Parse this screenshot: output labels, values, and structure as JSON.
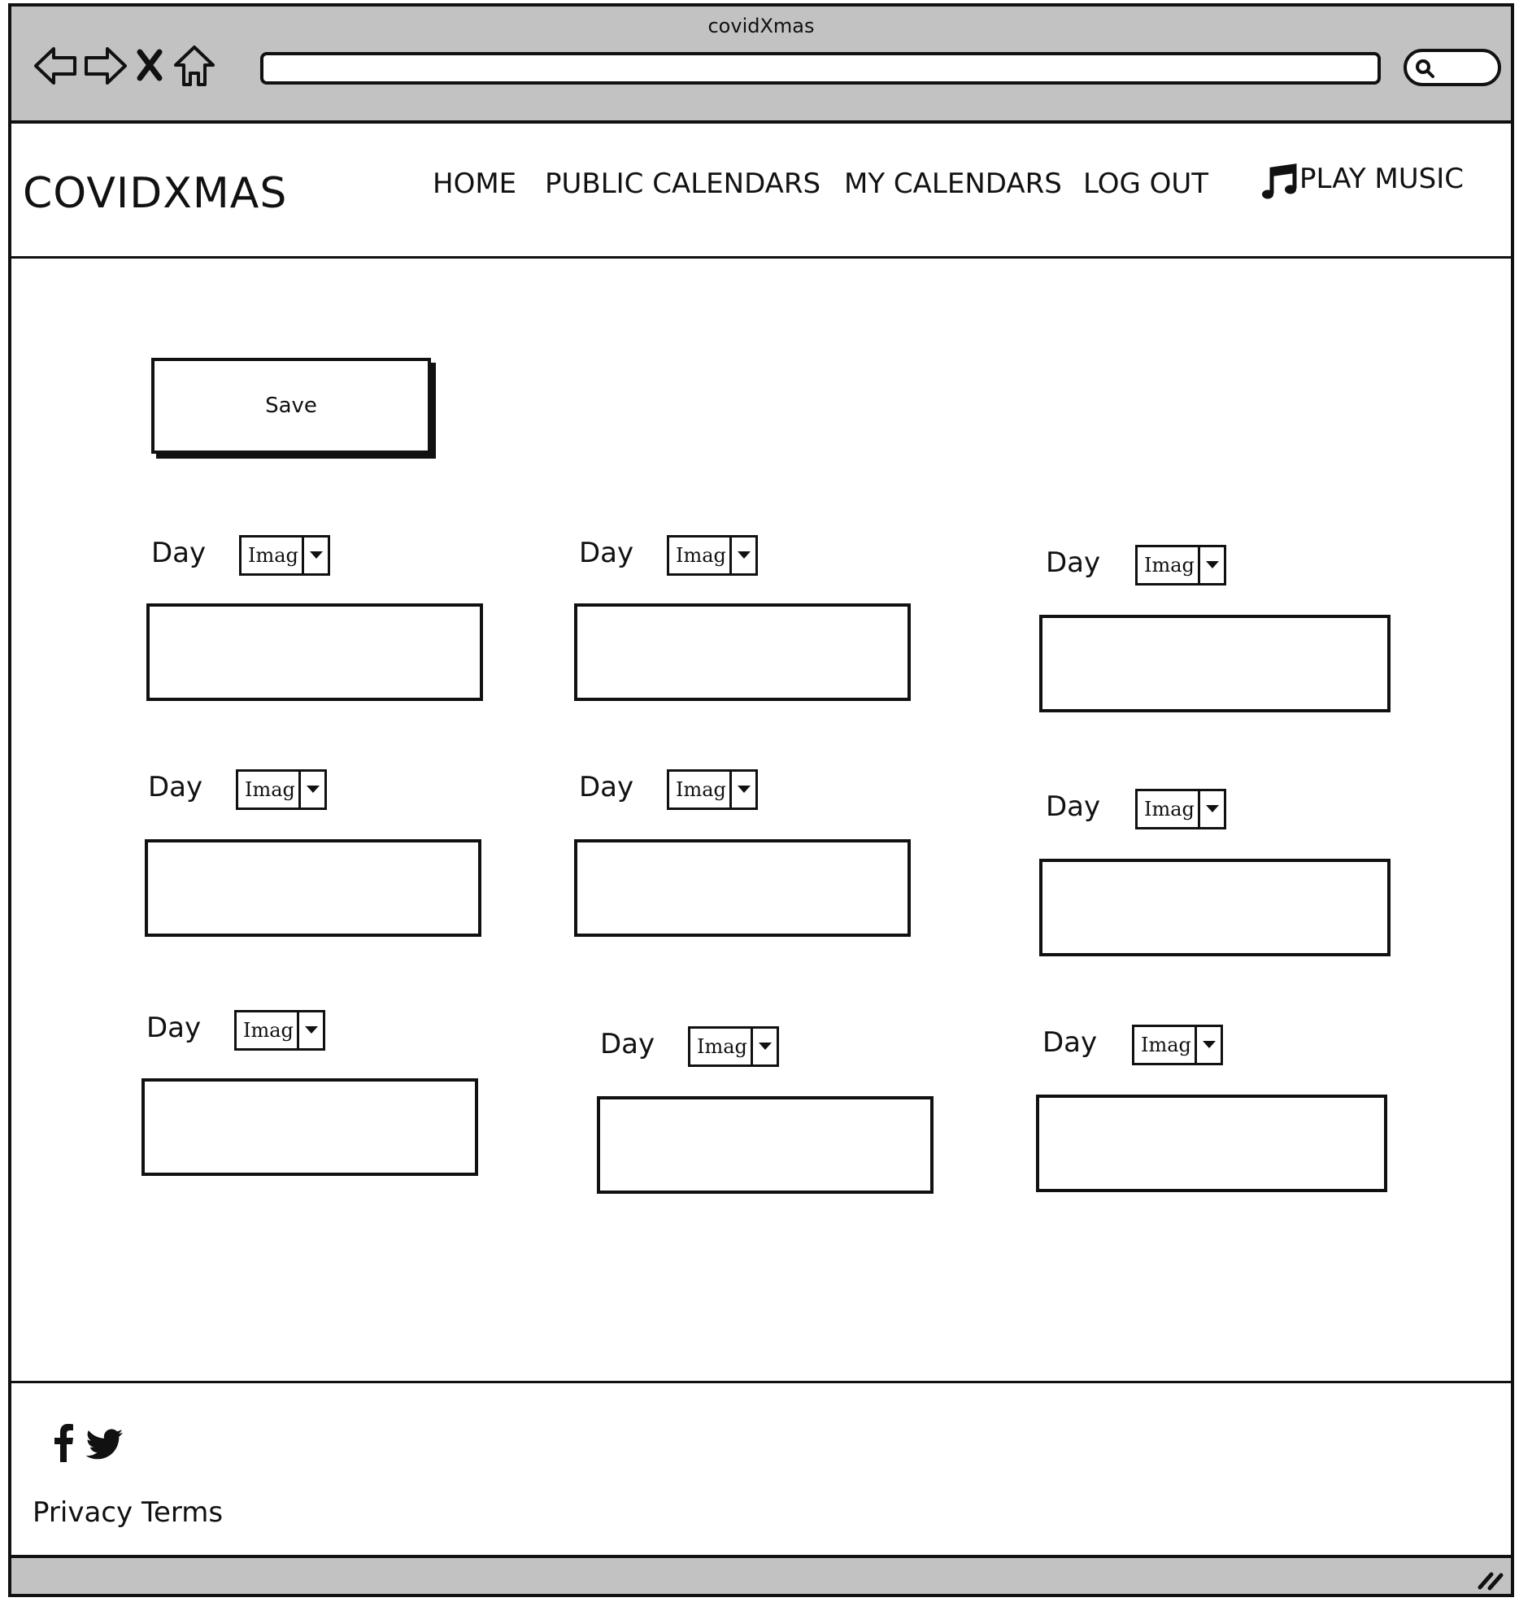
{
  "browser": {
    "window_title": "covidXmas",
    "address_value": "",
    "search_value": ""
  },
  "site": {
    "logo": "COVIDXMAS",
    "nav": {
      "home": "HOME",
      "public_calendars": "PUBLIC CALENDARS",
      "my_calendars": "MY CALENDARS",
      "log_out": "LOG OUT",
      "play_music": "PLAY MUSIC"
    }
  },
  "main": {
    "save_label": "Save",
    "days": [
      {
        "label": "Day",
        "image_select": "Imag",
        "text": ""
      },
      {
        "label": "Day",
        "image_select": "Imag",
        "text": ""
      },
      {
        "label": "Day",
        "image_select": "Imag",
        "text": ""
      },
      {
        "label": "Day",
        "image_select": "Imag",
        "text": ""
      },
      {
        "label": "Day",
        "image_select": "Imag",
        "text": ""
      },
      {
        "label": "Day",
        "image_select": "Imag",
        "text": ""
      },
      {
        "label": "Day",
        "image_select": "Imag",
        "text": ""
      },
      {
        "label": "Day",
        "image_select": "Imag",
        "text": ""
      },
      {
        "label": "Day",
        "image_select": "Imag",
        "text": ""
      }
    ]
  },
  "footer": {
    "privacy": "Privacy",
    "terms": "Terms",
    "social_icons": [
      "facebook-icon",
      "twitter-icon"
    ]
  }
}
